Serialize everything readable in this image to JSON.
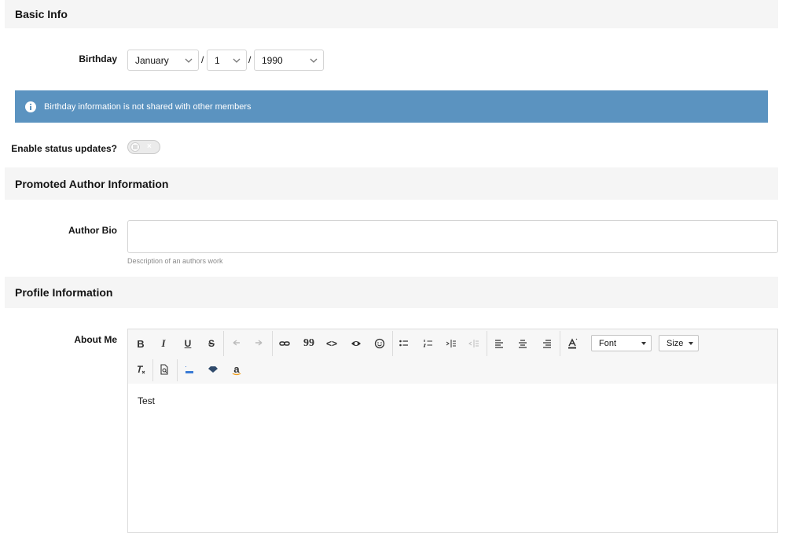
{
  "basic_info": {
    "title": "Basic Info"
  },
  "birthday": {
    "label": "Birthday",
    "month": "January",
    "day": "1",
    "year": "1990",
    "separator": "/"
  },
  "banner": {
    "text": "Birthday information is not shared with other members",
    "color": "#5b93c0"
  },
  "status_updates": {
    "label": "Enable status updates?",
    "enabled": false
  },
  "promoted": {
    "title": "Promoted Author Information"
  },
  "author_bio": {
    "label": "Author Bio",
    "value": "",
    "hint": "Description of an authors work"
  },
  "profile": {
    "title": "Profile Information"
  },
  "about_me": {
    "label": "About Me",
    "toolbar": {
      "bold": "B",
      "italic": "I",
      "underline": "U",
      "strike": "S",
      "quote": "99",
      "code": "<>",
      "font_label": "Font",
      "size_label": "Size",
      "amazon": "a"
    },
    "content": "Test"
  }
}
